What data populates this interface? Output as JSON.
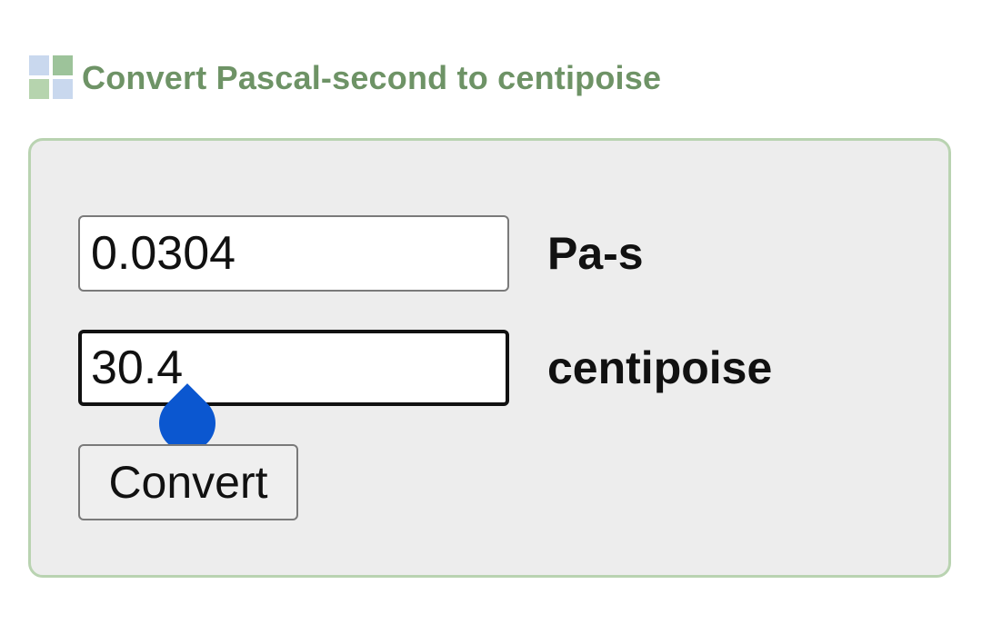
{
  "header": {
    "title": "Convert Pascal-second to centipoise",
    "logo_icon": "converter-logo-icon"
  },
  "converter": {
    "input_value": "0.0304",
    "input_unit": "Pa-s",
    "output_value": "30.4",
    "output_unit": "centipoise",
    "convert_label": "Convert"
  },
  "colors": {
    "title": "#6e9366",
    "panel_border": "#b9d3b1",
    "panel_bg": "#ededed",
    "selection_handle": "#0b57d0"
  }
}
